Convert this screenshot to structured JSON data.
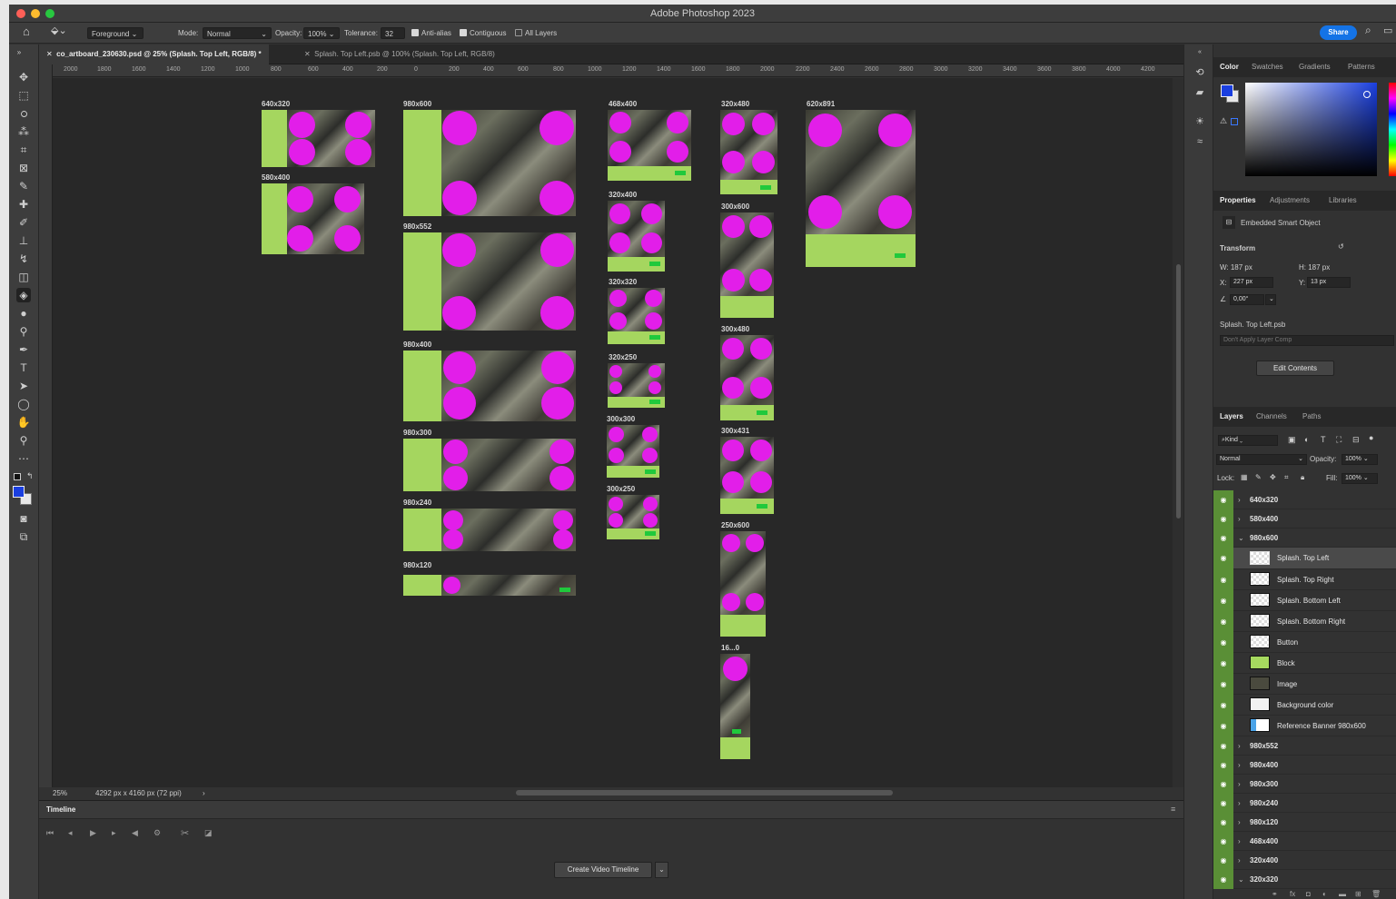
{
  "window": {
    "title": "Adobe Photoshop 2023"
  },
  "options": {
    "fill_source": "Foreground",
    "mode_label": "Mode:",
    "mode_value": "Normal",
    "opacity_label": "Opacity:",
    "opacity_value": "100%",
    "tolerance_label": "Tolerance:",
    "tolerance_value": "32",
    "antialias": "Anti-alias",
    "contiguous": "Contiguous",
    "all_layers": "All Layers",
    "share": "Share"
  },
  "tabs": [
    {
      "label": "co_artboard_230630.psd @ 25% (Splash. Top Left, RGB/8) *"
    },
    {
      "label": "Splash. Top Left.psb @ 100% (Splash. Top Left, RGB/8)"
    }
  ],
  "ruler": [
    "2000",
    "1800",
    "1600",
    "1400",
    "1200",
    "1000",
    "800",
    "600",
    "400",
    "200",
    "0",
    "200",
    "400",
    "600",
    "800",
    "1000",
    "1200",
    "1400",
    "1600",
    "1800",
    "2000",
    "2200",
    "2400",
    "2600",
    "2800",
    "3000",
    "3200",
    "3400",
    "3600",
    "3800",
    "4000",
    "4200"
  ],
  "artboard_labels": {
    "a640x320": "640x320",
    "a580x400": "580x400",
    "a980x600": "980x600",
    "a980x552": "980x552",
    "a980x400": "980x400",
    "a980x300": "980x300",
    "a980x240": "980x240",
    "a980x120": "980x120",
    "a468x400": "468x400",
    "a320x400": "320x400",
    "a320x320": "320x320",
    "a320x250": "320x250",
    "a300x300": "300x300",
    "a300x250": "300x250",
    "a320x480": "320x480",
    "a300x600": "300x600",
    "a300x480": "300x480",
    "a300x431": "300x431",
    "a250x600": "250x600",
    "a16x0": "16...0",
    "a620x891": "620x891"
  },
  "status": {
    "zoom": "25%",
    "doc_size": "4292 px x 4160 px (72 ppi)"
  },
  "timeline": {
    "title": "Timeline",
    "create_button": "Create Video Timeline"
  },
  "color_panel": {
    "tabs": [
      "Color",
      "Swatches",
      "Gradients",
      "Patterns"
    ]
  },
  "properties": {
    "tabs": [
      "Properties",
      "Adjustments",
      "Libraries"
    ],
    "type": "Embedded Smart Object",
    "transform_label": "Transform",
    "w": "W: 187 px",
    "h": "H: 187 px",
    "x_label": "X:",
    "x": "227 px",
    "y_label": "Y:",
    "y": "13 px",
    "angle": "0,00°",
    "file": "Splash. Top Left.psb",
    "layer_comp": "Don't Apply Layer Comp",
    "edit_contents": "Edit Contents"
  },
  "layers_panel": {
    "tabs": [
      "Layers",
      "Channels",
      "Paths"
    ],
    "filter": "Kind",
    "blend": "Normal",
    "opacity_label": "Opacity:",
    "opacity": "100%",
    "lock_label": "Lock:",
    "fill_label": "Fill:",
    "fill": "100%",
    "layers": [
      {
        "name": "640x320",
        "group": true,
        "open": false
      },
      {
        "name": "580x400",
        "group": true,
        "open": false
      },
      {
        "name": "980x600",
        "group": true,
        "open": true
      },
      {
        "name": "Splash. Top Left",
        "group": false,
        "selected": true
      },
      {
        "name": "Splash. Top Right",
        "group": false
      },
      {
        "name": "Splash. Bottom Left",
        "group": false
      },
      {
        "name": "Splash. Bottom Right",
        "group": false
      },
      {
        "name": "Button",
        "group": false
      },
      {
        "name": "Block",
        "group": false
      },
      {
        "name": "Image",
        "group": false
      },
      {
        "name": "Background color",
        "group": false
      },
      {
        "name": "Reference Banner 980x600",
        "group": false
      },
      {
        "name": "980x552",
        "group": true,
        "open": false
      },
      {
        "name": "980x400",
        "group": true,
        "open": false
      },
      {
        "name": "980x300",
        "group": true,
        "open": false
      },
      {
        "name": "980x240",
        "group": true,
        "open": false
      },
      {
        "name": "980x120",
        "group": true,
        "open": false
      },
      {
        "name": "468x400",
        "group": true,
        "open": false
      },
      {
        "name": "320x400",
        "group": true,
        "open": false
      },
      {
        "name": "320x320",
        "group": true,
        "open": true
      }
    ]
  },
  "colors": {
    "accent": "#1473e6",
    "splash": "#e21ee9",
    "block": "#a6d95f",
    "button": "#20c93c",
    "eye_green": "#5a8f36"
  }
}
